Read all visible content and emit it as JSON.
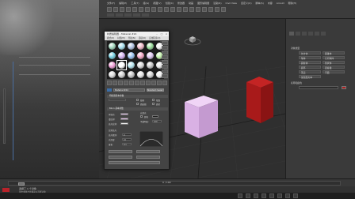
{
  "app": {
    "menus": [
      "文件(F)",
      "编辑(E)",
      "工具(T)",
      "组(G)",
      "视图(V)",
      "创建(C)",
      "修改器",
      "动画",
      "图形编辑器",
      "渲染(R)",
      "Civil View",
      "自定义(U)",
      "脚本(S)",
      "内容",
      "Arnold",
      "帮助(H)"
    ]
  },
  "material_editor": {
    "title": "材质编辑器 - Material #24",
    "menus": [
      "模式(D)",
      "材质(M)",
      "导航(N)",
      "选项(O)",
      "实用程序(U)"
    ],
    "slot_colors": [
      [
        "#a3d9c0",
        "#a7e0f0",
        "#b4c6e6",
        "#f0b8c8",
        "#9adf9c",
        "#f2f2f2"
      ],
      [
        "#78d2e4",
        "#d6b4f0",
        "#9cc5f2",
        "#f2a6c4",
        "#dfc7f2",
        "#c0f0a8"
      ],
      [
        "#f2a0d8",
        "#ffffff",
        "#b8e6f0",
        "#d8d8d8",
        "#c8c8c8",
        "#e8e8e8"
      ],
      [
        "#dcdcdc",
        "#d0d0d0",
        "#c6c6c6",
        "#e4e4e4",
        "#d4d4d4",
        "#f0f0f0"
      ]
    ],
    "material_name": "Material #24",
    "material_type": "Standard (Legacy)",
    "rollouts": {
      "basic_params": "明暗器基本参数",
      "blinn_params": "Blinn 基本参数"
    },
    "labels": {
      "ambient": "环境光:",
      "diffuse": "漫反射:",
      "specular": "高光反射:",
      "self_illum": "自发光",
      "color": "颜色",
      "opacity": "不透明度:",
      "specular_highlights": "反射高光",
      "specular_level": "高光级别:",
      "glossiness": "光泽度:",
      "soften": "柔化:",
      "wire": "线框",
      "two_sided": "双面",
      "face_map": "面贴图",
      "faceted": "面状"
    },
    "colors": {
      "ambient": "#d9b8e0",
      "diffuse": "#e7c4ee",
      "specular": "#f4f4f4",
      "self_illum": "#1f1f1f"
    },
    "values": {
      "opacity": "100",
      "specular_level": "0",
      "glossiness": "10",
      "soften": "0.1"
    }
  },
  "viewport": {
    "cube_pink": "#dfb7ec",
    "cube_red": "#b01e1e"
  },
  "command_panel": {
    "tabs": [
      "对象类型",
      "名称和颜色"
    ],
    "buttons": [
      "长方体",
      "圆锥体",
      "球体",
      "几何球体",
      "圆柱体",
      "管状体",
      "圆环",
      "四棱锥",
      "茶壶",
      "平面",
      "加强型文本"
    ]
  },
  "status": {
    "line1": "选择了 1 个对象",
    "line2": "单击或单击并拖动以选择对象",
    "frame": "0 / 100"
  }
}
